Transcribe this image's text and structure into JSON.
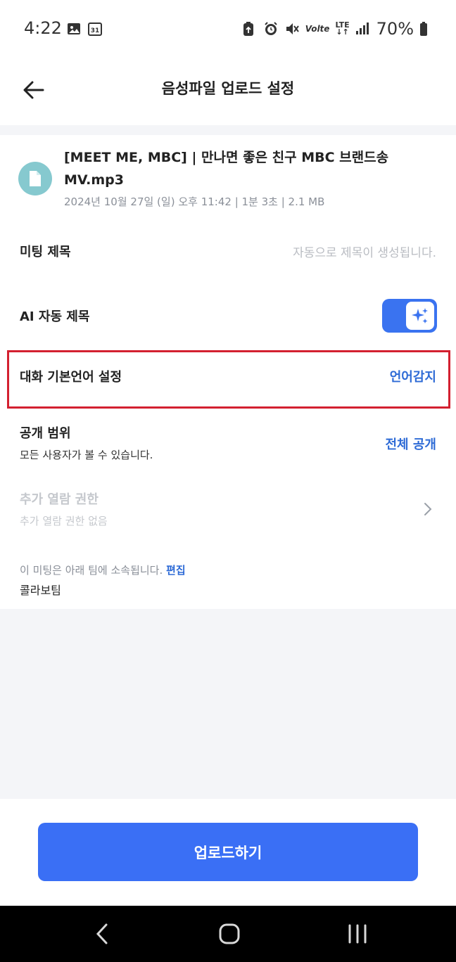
{
  "status_bar": {
    "time": "4:22",
    "battery": "70%",
    "network": "LTE",
    "volte": "Volte",
    "icons": [
      "gallery-icon",
      "calendar-icon",
      "battery-saver-icon",
      "alarm-icon",
      "mute-icon",
      "volte-icon",
      "lte-icon",
      "signal-icon",
      "battery-icon"
    ],
    "calendar_day": "31"
  },
  "header": {
    "title": "음성파일 업로드 설정",
    "back_icon": "arrow-left-icon"
  },
  "file": {
    "icon": "document-icon",
    "name": "[MEET ME, MBC] | 만나면 좋은 친구 MBC 브랜드송 MV.mp3",
    "meta": "2024년 10월 27일 (일) 오후 11:42 | 1분 3초 | 2.1 MB"
  },
  "settings": {
    "meeting_title": {
      "label": "미팅 제목",
      "placeholder": "자동으로 제목이 생성됩니다."
    },
    "ai_auto_title": {
      "label": "AI 자동 제목",
      "enabled": true
    },
    "language": {
      "label": "대화 기본언어 설정",
      "value": "언어감지"
    },
    "visibility": {
      "label": "공개 범위",
      "description": "모든 사용자가 볼 수 있습니다.",
      "value": "전체 공개"
    },
    "extra_permission": {
      "label": "추가 열람 권한",
      "description": "추가 열람 권한 없음"
    }
  },
  "team": {
    "note": "이 미팅은 아래 팀에 소속됩니다.",
    "edit_label": "편집",
    "name": "콜라보팀"
  },
  "actions": {
    "upload_label": "업로드하기"
  },
  "colors": {
    "accent": "#3a6ff5",
    "link": "#2e6bd6",
    "highlight_border": "#d32030",
    "file_icon_bg": "#86c9cf"
  }
}
